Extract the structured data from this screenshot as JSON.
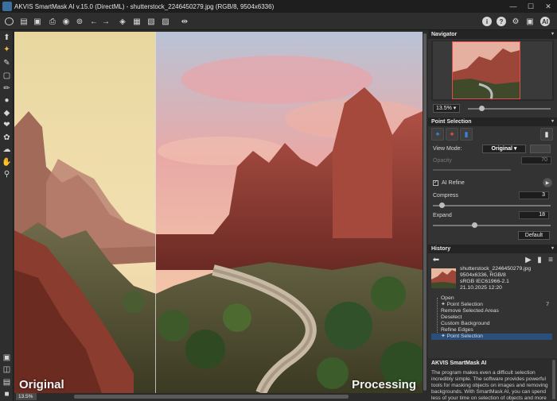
{
  "window": {
    "title": "AKVIS SmartMask AI v.15.0 (DirectML) - shutterstock_2246450279.jpg (RGB/8, 9504x6336)",
    "minimize": "—",
    "maximize": "☐",
    "close": "✕"
  },
  "canvas": {
    "left_label": "Original",
    "right_label": "Processing",
    "zoom": "13.5%"
  },
  "navigator": {
    "title": "Navigator",
    "zoom": "13.5% ▾"
  },
  "point_selection": {
    "title": "Point Selection",
    "view_mode_label": "View Mode:",
    "view_mode_value": "Original",
    "opacity_label": "Opacity",
    "opacity_value": "70",
    "ai_refine_label": "AI Refine",
    "compress_label": "Compress",
    "compress_value": "3",
    "expand_label": "Expand",
    "expand_value": "18",
    "default_label": "Default"
  },
  "history": {
    "title": "History",
    "file_name": "shutterstock_2246450279.jpg",
    "file_dims": "9504x6336, RGB/8",
    "file_profile": "sRGB IEC61966-2.1",
    "file_date": "21.10.2025 12:20",
    "items": [
      {
        "label": "Open",
        "count": ""
      },
      {
        "label": "Point Selection",
        "count": "7"
      },
      {
        "label": "Remove Selected Areas",
        "count": ""
      },
      {
        "label": "Deselect",
        "count": ""
      },
      {
        "label": "Custom Background",
        "count": ""
      },
      {
        "label": "Refine Edges",
        "count": ""
      },
      {
        "label": "Point Selection",
        "count": ""
      }
    ]
  },
  "about": {
    "title": "AKVIS SmartMask AI",
    "text": "The program makes even a difficult selection incredibly simple. The software provides powerful tools for masking objects on images and removing backgrounds. With SmartMask AI, you can spend less of your time on selection of objects and more"
  },
  "colors": {
    "accent_red": "#e84a4a",
    "selection_blue": "#2a4f7a",
    "panel_bg": "#333333"
  }
}
